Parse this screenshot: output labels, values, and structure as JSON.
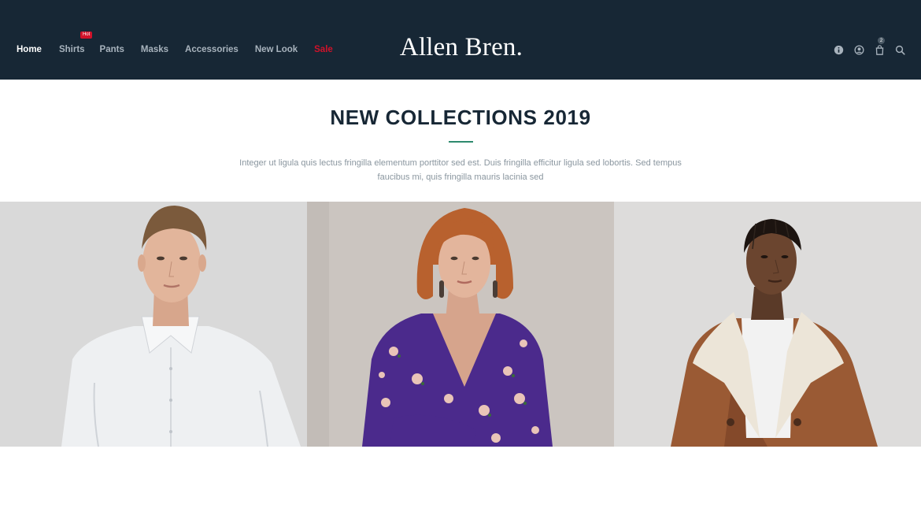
{
  "nav": {
    "items": [
      {
        "label": "Home"
      },
      {
        "label": "Shirts",
        "badge": "Hot"
      },
      {
        "label": "Pants"
      },
      {
        "label": "Masks"
      },
      {
        "label": "Accessories"
      },
      {
        "label": "New Look"
      },
      {
        "label": "Sale"
      }
    ]
  },
  "logo": {
    "text": "Allen Bren."
  },
  "header_icons": [
    {
      "icon": "info-icon"
    },
    {
      "icon": "user-icon"
    },
    {
      "icon": "cart-icon",
      "count": "2"
    },
    {
      "icon": "search-icon"
    }
  ],
  "intro": {
    "title": "NEW COLLECTIONS 2019",
    "description": "Integer ut ligula quis lectus fringilla elementum porttitor sed est. Duis fringilla efficitur ligula sed lobortis. Sed tempus faucibus mi, quis fringilla mauris lacinia sed"
  },
  "colors": {
    "header_bg": "#172735",
    "sale_red": "#d0122a",
    "accent_green": "#2e8a6e",
    "title_dark": "#172735"
  },
  "gallery": [
    {
      "name": "white-shirt-model"
    },
    {
      "name": "purple-floral-dress-model"
    },
    {
      "name": "brown-shearling-coat-model"
    }
  ]
}
